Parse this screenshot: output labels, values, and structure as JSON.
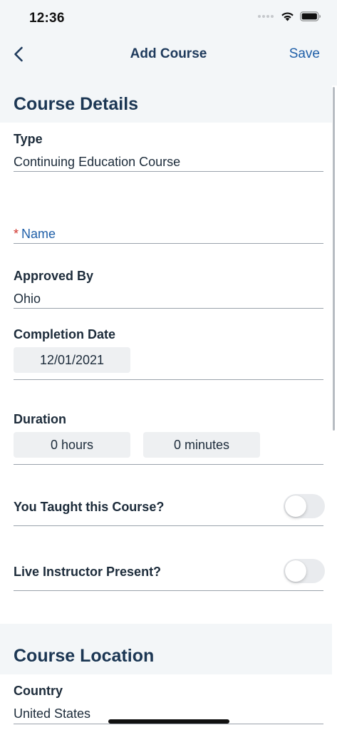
{
  "status_bar": {
    "time": "12:36"
  },
  "nav": {
    "title": "Add Course",
    "save_label": "Save",
    "back_icon": "chevron-left-icon"
  },
  "course_details": {
    "section_title": "Course Details",
    "type": {
      "label": "Type",
      "value": "Continuing Education Course"
    },
    "name": {
      "required_mark": "*",
      "label": "Name",
      "value": ""
    },
    "approved_by": {
      "label": "Approved By",
      "value": "Ohio"
    },
    "completion_date": {
      "label": "Completion Date",
      "value": "12/01/2021"
    },
    "duration": {
      "label": "Duration",
      "hours": "0 hours",
      "minutes": "0 minutes"
    },
    "taught": {
      "label": "You Taught this Course?",
      "on": false
    },
    "live_instructor": {
      "label": "Live Instructor Present?",
      "on": false
    }
  },
  "course_location": {
    "section_title": "Course Location",
    "country": {
      "label": "Country",
      "value": "United States"
    }
  },
  "colors": {
    "accent": "#1f5fa8",
    "heading": "#1b3653",
    "required": "#d0352e",
    "section_bg": "#f3f6f8"
  }
}
